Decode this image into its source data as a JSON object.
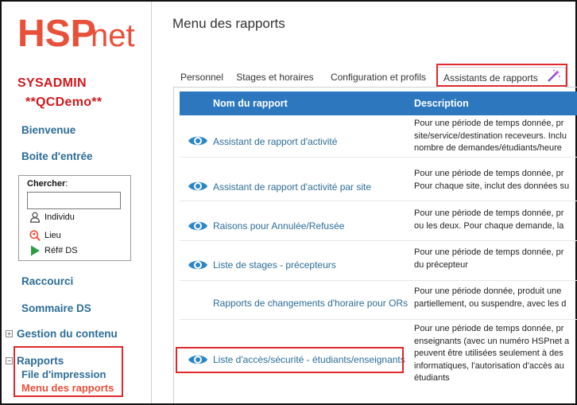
{
  "app": {
    "logo_text_hsp": "HSP",
    "logo_text_net": "net",
    "brand_color": "#e8503a"
  },
  "sidebar": {
    "user": "SYSADMIN",
    "environment": "**QCDemo**",
    "links": {
      "welcome": "Bienvenue",
      "inbox": "Boite d'entrée",
      "shortcut": "Raccourci",
      "ds_summary": "Sommaire DS"
    },
    "search": {
      "label": "Chercher",
      "colon": ":",
      "value": "",
      "options": [
        {
          "label": "Individu",
          "icon": "person-icon"
        },
        {
          "label": "Lieu",
          "icon": "location-search-icon"
        },
        {
          "label": "Réf# DS",
          "icon": "play-arrow-icon"
        }
      ]
    },
    "content_management": {
      "toggle": "+",
      "label": "Gestion du contenu"
    },
    "reports": {
      "toggle": "−",
      "label": "Rapports",
      "items": [
        {
          "label": "File d'impression"
        },
        {
          "label": "Menu des rapports"
        }
      ]
    }
  },
  "main": {
    "title": "Menu des rapports",
    "tabs": [
      {
        "label": "Personnel"
      },
      {
        "label": "Stages et horaires"
      },
      {
        "label": "Configuration et profils"
      },
      {
        "label": "Assistants de rapports",
        "active": true
      }
    ],
    "table": {
      "headers": {
        "name": "Nom du rapport",
        "description": "Description"
      },
      "rows": [
        {
          "name": "Assistant de rapport d'activité",
          "has_preview": true,
          "desc": [
            "Pour une période de temps donnée, pr",
            "site/service/destination receveurs. Inclu",
            "nombre de demandes/étudiants/heure"
          ]
        },
        {
          "name": "Assistant de rapport d'activité par site",
          "has_preview": true,
          "desc": [
            "Pour une période de temps donnée, pr",
            "Pour chaque site, inclut des données su"
          ]
        },
        {
          "name": "Raisons pour Annulée/Refusée",
          "has_preview": true,
          "desc": [
            "Pour une période de temps donnée, pr",
            "ou les deux. Pour chaque demande, la"
          ]
        },
        {
          "name": "Liste de stages - précepteurs",
          "has_preview": true,
          "desc": [
            "Pour une période de temps donnée, pr",
            "du précepteur"
          ]
        },
        {
          "name": "Rapports de changements d'horaire pour ORs",
          "has_preview": false,
          "desc": [
            "Pour une période donnée, produit une",
            "partiellement, ou suspendre, avec les d"
          ]
        },
        {
          "name": "Liste d'accès/sécurité - étudiants/enseignants",
          "has_preview": true,
          "desc": [
            "Pour une période de temps donnée, pr",
            "enseignants (avec un numéro HSPnet a",
            "peuvent être utilisées seulement à des",
            "informatiques, l'autorisation d'accès au",
            "étudiants"
          ]
        }
      ]
    }
  },
  "colors": {
    "link": "#2c6c96",
    "header_bg": "#2c77be",
    "highlight": "#e0282d",
    "user_red": "#d0181c",
    "eye": "#2d86c4",
    "active_sub": "#e8503a"
  }
}
